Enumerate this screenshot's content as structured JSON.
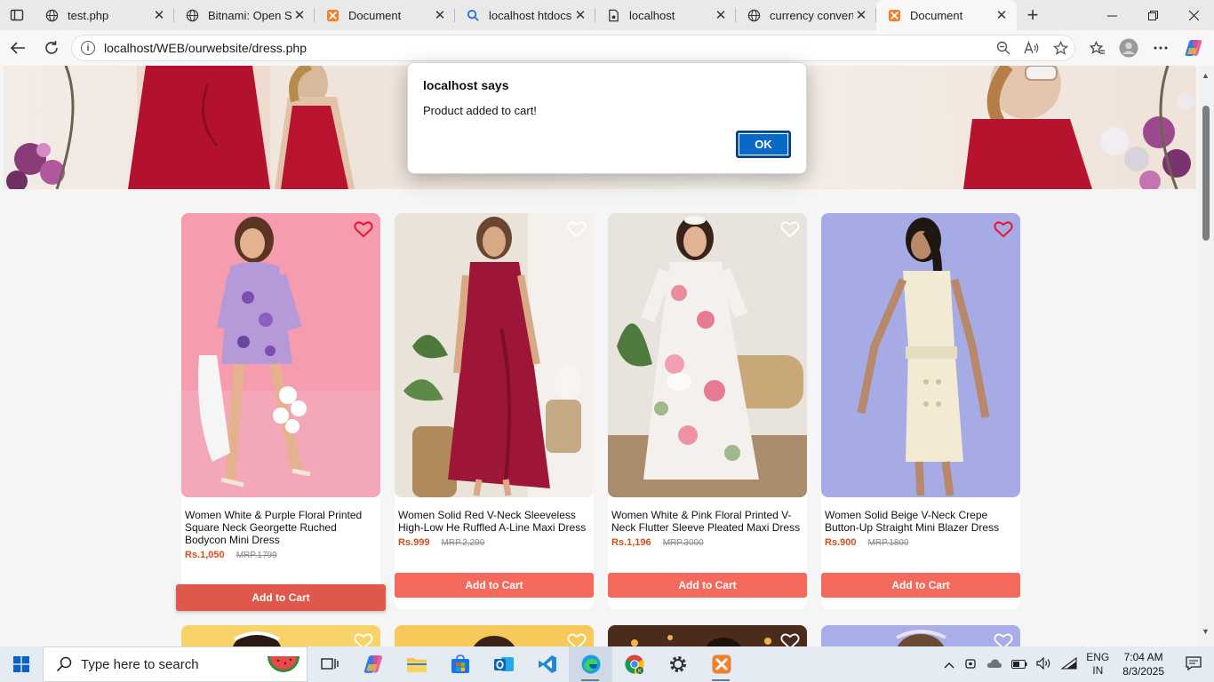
{
  "browser": {
    "tabs": [
      {
        "title": "test.php",
        "icon": "globe-icon"
      },
      {
        "title": "Bitnami: Open Sou",
        "icon": "globe-icon"
      },
      {
        "title": "Document",
        "icon": "xampp-icon"
      },
      {
        "title": "localhost htdocs in",
        "icon": "search-icon"
      },
      {
        "title": "localhost",
        "icon": "document-icon"
      },
      {
        "title": "currency converte",
        "icon": "globe-icon"
      },
      {
        "title": "Document",
        "icon": "xampp-icon",
        "active": true
      }
    ],
    "url": "localhost/WEB/ourwebsite/dress.php"
  },
  "dialog": {
    "title": "localhost says",
    "message": "Product added to cart!",
    "ok_label": "OK"
  },
  "products": [
    {
      "name": "Women White & Purple Floral Printed Square Neck Georgette Ruched Bodycon Mini Dress",
      "price": "Rs.1,050",
      "mrp": "MRP.1799",
      "button": "Add to Cart",
      "wishlisted": true
    },
    {
      "name": "Women Solid Red V-Neck Sleeveless High-Low He Ruffled A-Line Maxi Dress",
      "price": "Rs.999",
      "mrp": "MRP.2,299",
      "button": "Add to Cart",
      "wishlisted": false
    },
    {
      "name": "Women White & Pink Floral Printed V-Neck Flutter Sleeve Pleated Maxi Dress",
      "price": "Rs.1,196",
      "mrp": "MRP.3000",
      "button": "Add to Cart",
      "wishlisted": false
    },
    {
      "name": "Women Solid Beige V-Neck Crepe Button-Up Straight Mini Blazer Dress",
      "price": "Rs.900",
      "mrp": "MRP.1800",
      "button": "Add to Cart",
      "wishlisted": true
    }
  ],
  "taskbar": {
    "search_placeholder": "Type here to search",
    "lang_top": "ENG",
    "lang_bottom": "IN",
    "time": "7:04 AM",
    "date": "8/3/2025"
  },
  "colors": {
    "accent_button": "#f36a5c",
    "price": "#d4501a",
    "dialog_ok": "#0a69c7"
  }
}
